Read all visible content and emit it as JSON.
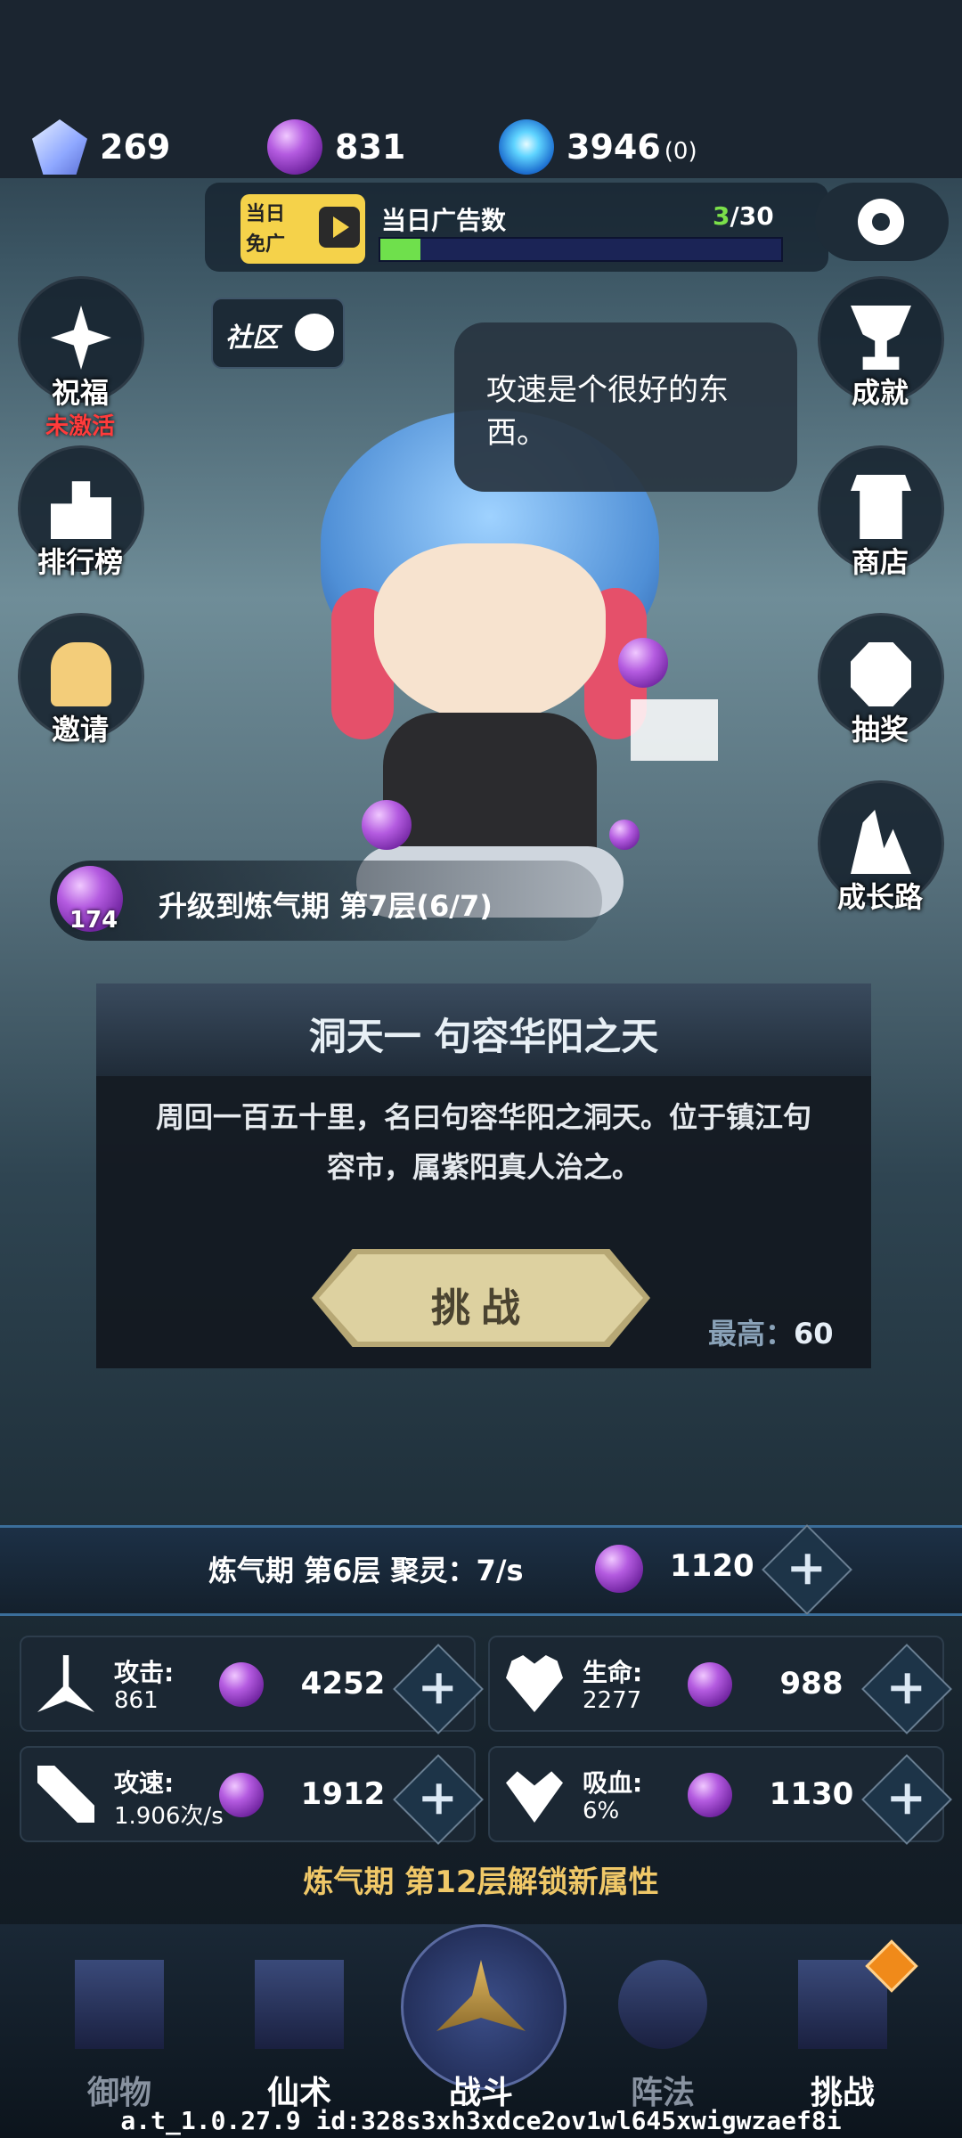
{
  "resources": [
    {
      "icon": "crystal-icon",
      "value": "269"
    },
    {
      "icon": "purple-orb-icon",
      "value": "831"
    },
    {
      "icon": "spirit-energy-icon",
      "value": "3946",
      "sub": "(0)"
    }
  ],
  "ad": {
    "logo_line1": "当日",
    "logo_line2": "免广",
    "title": "当日广告数",
    "count_current": "3",
    "count_total": "/30",
    "progress": 0.1
  },
  "left_menu": [
    {
      "label": "祝福",
      "status": "未激活",
      "icon": "blessing-compass-icon"
    },
    {
      "label": "排行榜",
      "icon": "leaderboard-podium-icon"
    },
    {
      "label": "邀请",
      "icon": "invite-person-icon"
    }
  ],
  "right_menu": [
    {
      "label": "成就",
      "icon": "trophy-icon"
    },
    {
      "label": "商店",
      "icon": "shop-icon"
    },
    {
      "label": "抽奖",
      "icon": "lottery-icon"
    },
    {
      "label": "成长路",
      "icon": "growth-path-icon"
    }
  ],
  "community": {
    "label": "社区"
  },
  "speech": "攻速是个很好的东西。",
  "upgrade": {
    "orb_count": "174",
    "text": "升级到炼气期 第7层(6/7)"
  },
  "dungeon": {
    "title": "洞天一 句容华阳之天",
    "description": "周回一百五十里，名曰句容华阳之洞天。位于镇江句容市，属紫阳真人治之。",
    "challenge_label": "挑战",
    "best_label": "最高：",
    "best_value": "60"
  },
  "level": {
    "text": "炼气期 第6层 聚灵：7/s",
    "orbs": "1120"
  },
  "stats": [
    {
      "name": "攻击:",
      "value": "861",
      "cost": "4252",
      "icon": "sword-icon"
    },
    {
      "name": "生命:",
      "value": "2277",
      "cost": "988",
      "icon": "heart-icon"
    },
    {
      "name": "攻速:",
      "value": "1.906次/s",
      "cost": "1912",
      "icon": "attack-speed-icon"
    },
    {
      "name": "吸血:",
      "value": "6%",
      "cost": "1130",
      "icon": "lifesteal-icon"
    }
  ],
  "unlock_text": "炼气期 第12层解锁新属性",
  "nav": [
    {
      "label": "御物",
      "active": false
    },
    {
      "label": "仙术",
      "active": false
    },
    {
      "label": "战斗",
      "active": true
    },
    {
      "label": "阵法",
      "active": false
    },
    {
      "label": "挑战",
      "active": false
    }
  ],
  "footer": "a.t_1.0.27.9 id:328s3xh3xdce2ov1wl645xwigwzaef8i"
}
